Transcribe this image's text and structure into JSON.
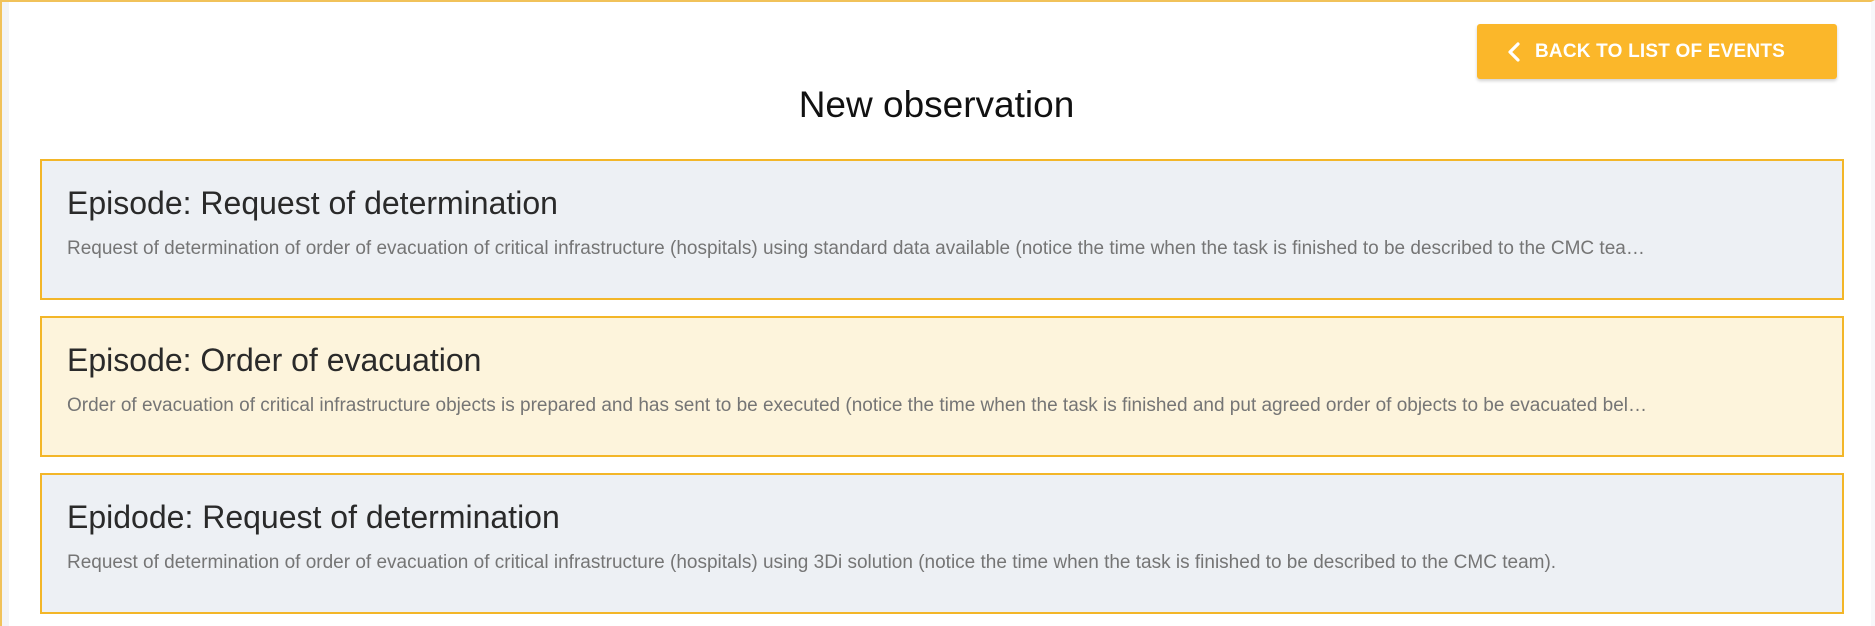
{
  "header": {
    "back_button_label": "BACK TO LIST OF EVENTS",
    "back_button_icon": "chevron-left-icon",
    "title": "New observation"
  },
  "episodes": [
    {
      "title": "Episode: Request of determination",
      "description": "Request of determination of order of evacuation of critical infrastructure (hospitals) using standard data available (notice the time when the task is finished to be described to the CMC tea…",
      "state": "default"
    },
    {
      "title": "Episode: Order of evacuation",
      "description": "Order of evacuation of critical infrastructure objects is prepared and has sent to be executed (notice the time when the task is finished and put agreed order of objects to be evacuated bel…",
      "state": "highlighted"
    },
    {
      "title": "Epidode: Request of determination",
      "description": "Request of determination of order of evacuation of critical infrastructure (hospitals) using 3Di solution (notice the time when the task is finished to be described to the CMC team).",
      "state": "default"
    }
  ],
  "colors": {
    "accent": "#fbb72a",
    "card_border": "#f3b628",
    "card_default_bg": "#edf0f4",
    "card_highlight_bg": "#fdf4dc"
  }
}
